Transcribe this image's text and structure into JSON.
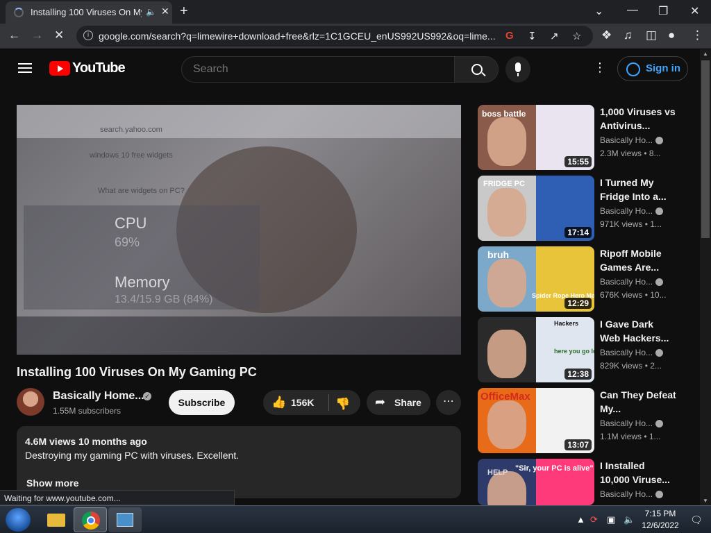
{
  "browser": {
    "tab_title": "Installing 100 Viruses On My",
    "url": "google.com/search?q=limewire+download+free&rlz=1C1GCEU_enUS992US992&oq=lime...",
    "status": "Waiting for www.youtube.com..."
  },
  "youtube": {
    "logo_text": "YouTube",
    "search_placeholder": "Search",
    "signin_label": "Sign in"
  },
  "player": {
    "overlay_url": "search.yahoo.com",
    "overlay_query": "windows 10 free widgets",
    "overlay_question": "What are widgets on PC?",
    "cpu_label": "CPU",
    "cpu_value": "69%",
    "memory_label": "Memory",
    "memory_value": "13.4/15.9 GB (84%)"
  },
  "video": {
    "title": "Installing 100 Viruses On My Gaming PC",
    "channel_name": "Basically Home...",
    "subscribers": "1.55M subscribers",
    "subscribe_label": "Subscribe",
    "likes": "156K",
    "share_label": "Share",
    "views_date": "4.6M views  10 months ago",
    "description": "Destroying my gaming PC with viruses. Excellent.",
    "show_more": "Show more"
  },
  "recommendations": [
    {
      "title": "1,000 Viruses vs Antivirus...",
      "channel": "Basically Ho...",
      "views": "2.3M views • 8...",
      "duration": "15:55",
      "thumb_color": "#8a5a4a",
      "accent": "#e9e4ef"
    },
    {
      "title": "I Turned My Fridge Into a...",
      "channel": "Basically Ho...",
      "views": "971K views • 1...",
      "duration": "17:14",
      "thumb_color": "#c9c9c9",
      "accent": "#2f5fb5"
    },
    {
      "title": "Ripoff Mobile Games Are...",
      "channel": "Basically Ho...",
      "views": "676K views • 10...",
      "duration": "12:29",
      "thumb_color": "#7ca8c9",
      "accent": "#e7c43a"
    },
    {
      "title": "I Gave Dark Web Hackers...",
      "channel": "Basically Ho...",
      "views": "829K views • 2...",
      "duration": "12:38",
      "thumb_color": "#2a2a2a",
      "accent": "#dfe6ef"
    },
    {
      "title": "Can They Defeat My...",
      "channel": "Basically Ho...",
      "views": "1.1M views • 1...",
      "duration": "13:07",
      "thumb_color": "#e86b1a",
      "accent": "#f2f2f2"
    },
    {
      "title": "I Installed 10,000 Viruse...",
      "channel": "Basically Ho...",
      "views": "",
      "duration": "",
      "thumb_color": "#2d3a6a",
      "accent": "#ff3a7a"
    }
  ],
  "rec_overlay_texts": {
    "r0": "boss battle",
    "r1": "FRIDGE PC",
    "r2": "bruh",
    "r2b": "Spider Rope Hero Man",
    "r3": "Hackers",
    "r3b": "here you go lol",
    "r4": "OfficeMax",
    "r5": "\"Sir, your PC is alive\"",
    "r5b": "HELP"
  },
  "taskbar": {
    "time": "7:15 PM",
    "date": "12/6/2022"
  }
}
